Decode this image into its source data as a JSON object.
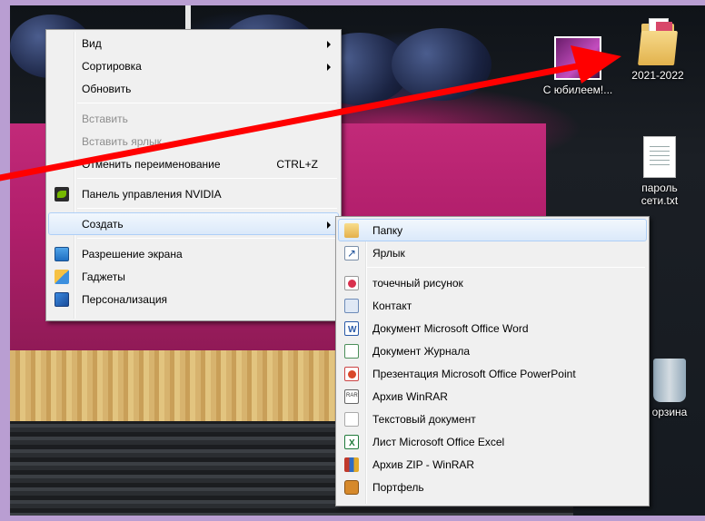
{
  "desktop": {
    "icons": [
      {
        "label": "С юбилеем!...",
        "icon": "photo-icon"
      },
      {
        "label": "2021-2022",
        "icon": "folder-icon"
      },
      {
        "label": "пароль сети.txt",
        "icon": "text-file-icon"
      },
      {
        "label": "орзина",
        "icon": "recycle-bin-icon"
      }
    ]
  },
  "context_menu": {
    "items": [
      {
        "label": "Вид",
        "submenu": true
      },
      {
        "label": "Сортировка",
        "submenu": true
      },
      {
        "label": "Обновить"
      },
      {
        "label": "Вставить",
        "disabled": true
      },
      {
        "label": "Вставить ярлык",
        "disabled": true
      },
      {
        "label": "Отменить переименование",
        "shortcut": "CTRL+Z"
      },
      {
        "label": "Панель управления NVIDIA",
        "icon": "nvidia-icon"
      },
      {
        "label": "Создать",
        "submenu": true,
        "highlighted": true
      },
      {
        "label": "Разрешение экрана",
        "icon": "screen-resolution-icon"
      },
      {
        "label": "Гаджеты",
        "icon": "gadgets-icon"
      },
      {
        "label": "Персонализация",
        "icon": "personalization-icon"
      }
    ]
  },
  "create_submenu": {
    "items": [
      {
        "label": "Папку",
        "icon": "folder-icon",
        "highlighted": true
      },
      {
        "label": "Ярлык",
        "icon": "shortcut-icon"
      },
      {
        "label": "точечный рисунок",
        "icon": "bitmap-icon"
      },
      {
        "label": "Контакт",
        "icon": "contact-icon"
      },
      {
        "label": "Документ Microsoft Office Word",
        "icon": "word-icon"
      },
      {
        "label": "Документ Журнала",
        "icon": "journal-icon"
      },
      {
        "label": "Презентация Microsoft Office PowerPoint",
        "icon": "powerpoint-icon"
      },
      {
        "label": "Архив WinRAR",
        "icon": "winrar-icon"
      },
      {
        "label": "Текстовый документ",
        "icon": "text-document-icon"
      },
      {
        "label": "Лист Microsoft Office Excel",
        "icon": "excel-icon"
      },
      {
        "label": "Архив ZIP - WinRAR",
        "icon": "zip-icon"
      },
      {
        "label": "Портфель",
        "icon": "briefcase-icon"
      }
    ]
  },
  "colors": {
    "arrow": "#ff0000",
    "menu_background": "#f0f0f0",
    "highlight_border": "#aecff7"
  }
}
